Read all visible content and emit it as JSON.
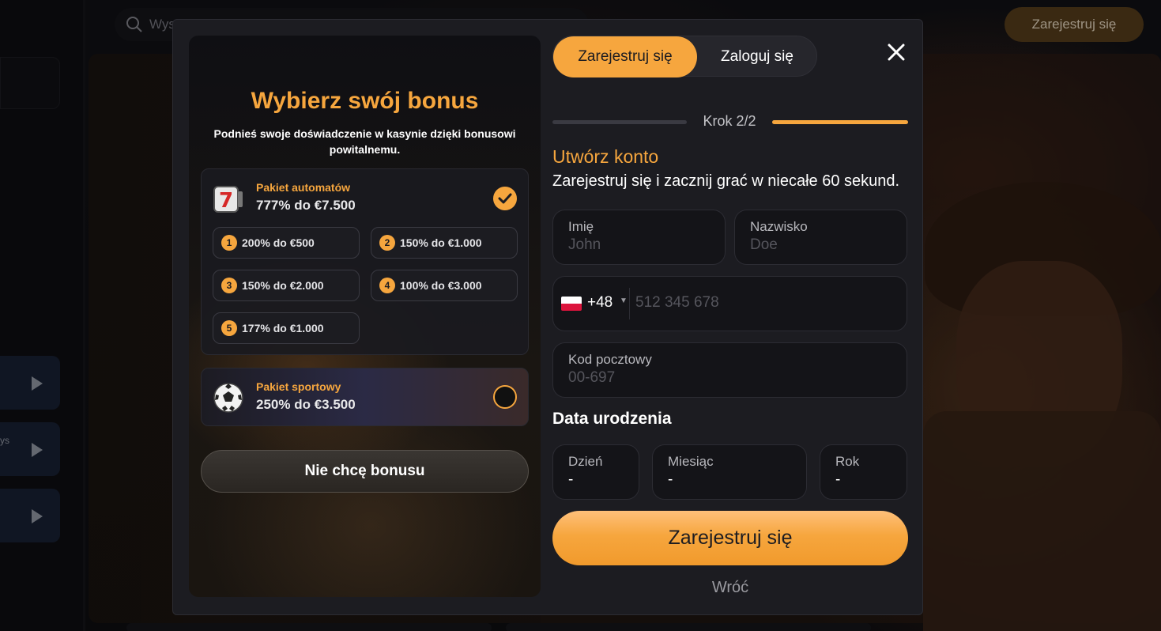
{
  "background": {
    "search_placeholder": "Wys",
    "register_label": "Zarejestruj się",
    "sidebar_text": "ys"
  },
  "modal": {
    "tabs": {
      "register": "Zarejestruj się",
      "login": "Zaloguj się"
    },
    "bonus": {
      "title": "Wybierz swój bonus",
      "subtitle": "Podnieś swoje doświadczenie w kasynie dzięki bonusowi powitalnemu.",
      "packages": [
        {
          "name": "Pakiet automatów",
          "value": "777% do €7.500",
          "icon": "slot-seven-icon",
          "selected": true,
          "tiers": [
            {
              "num": "1",
              "label": "200% do €500"
            },
            {
              "num": "2",
              "label": "150% do €1.000"
            },
            {
              "num": "3",
              "label": "150% do €2.000"
            },
            {
              "num": "4",
              "label": "100% do €3.000"
            },
            {
              "num": "5",
              "label": "177% do €1.000"
            }
          ]
        },
        {
          "name": "Pakiet sportowy",
          "value": "250% do €3.500",
          "icon": "soccer-ball-icon",
          "selected": false
        }
      ],
      "no_bonus": "Nie chcę bonusu"
    },
    "steps": {
      "label": "Krok 2/2",
      "current": 2,
      "total": 2
    },
    "form": {
      "title": "Utwórz konto",
      "subtitle": "Zarejestruj się i zacznij grać w niecałe 60 sekund.",
      "first_name": {
        "label": "Imię",
        "placeholder": "John"
      },
      "last_name": {
        "label": "Nazwisko",
        "placeholder": "Doe"
      },
      "phone": {
        "code": "+48",
        "placeholder": "512 345 678",
        "country": "PL"
      },
      "postal_code": {
        "label": "Kod pocztowy",
        "placeholder": "00-697"
      },
      "dob_title": "Data urodzenia",
      "dob": {
        "day": {
          "label": "Dzień",
          "value": "-"
        },
        "month": {
          "label": "Miesiąc",
          "value": "-"
        },
        "year": {
          "label": "Rok",
          "value": "-"
        }
      },
      "submit": "Zarejestruj się",
      "back": "Wróć"
    },
    "colors": {
      "accent": "#f6a63e",
      "surface": "#1c1c21"
    }
  }
}
